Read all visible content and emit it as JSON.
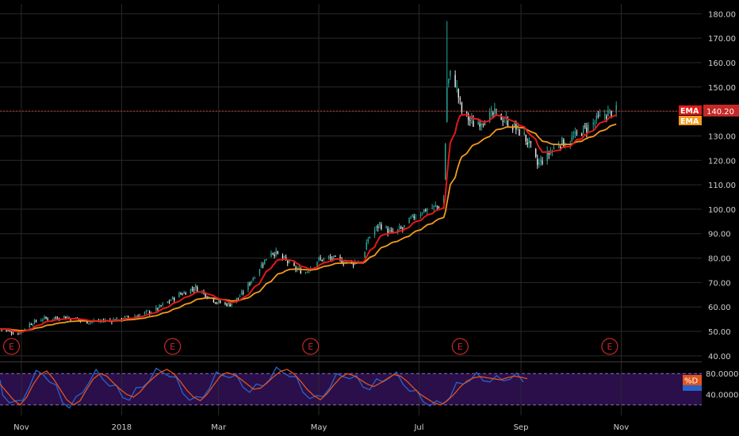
{
  "colors": {
    "background": "#000000",
    "grid": "#2a2a2a",
    "candle_up": "#26a69a",
    "candle_down": "#e8e8e8",
    "ema_fast": "#e01a1a",
    "ema_slow": "#f39a1e",
    "price_line": "#c62828",
    "stoch_k": "#2a62c9",
    "stoch_d": "#e0541c",
    "stoch_fill": "#2a0f4a",
    "earnings": "#c62828",
    "axis_text": "#cfcfcf"
  },
  "chart_data": [
    {
      "type": "candlestick",
      "panel": "price",
      "y_ticks": [
        "40.00",
        "50.00",
        "60.00",
        "70.00",
        "80.00",
        "90.00",
        "100.00",
        "110.00",
        "120.00",
        "130.00",
        "140.00",
        "150.00",
        "160.00",
        "170.00",
        "180.00"
      ],
      "ylim": [
        38,
        184
      ],
      "x_ticks": [
        "Nov",
        "2018",
        "Mar",
        "May",
        "Jul",
        "Sep",
        "Nov"
      ],
      "x_tick_dates": [
        "2017-11-01",
        "2018-01-01",
        "2018-03-01",
        "2018-05-01",
        "2018-07-01",
        "2018-09-01",
        "2018-11-01"
      ],
      "x_range": [
        "2017-10-19",
        "2018-12-20"
      ],
      "price_label": "140.20",
      "price_value": 140.2,
      "legend": [
        {
          "label": "EMA",
          "color": "#e01a1a"
        },
        {
          "label": "EMA",
          "color": "#f39a1e"
        }
      ],
      "earnings_marker_label": "E",
      "earnings_dates": [
        "2017-10-26",
        "2018-02-01",
        "2018-04-26",
        "2018-07-26",
        "2018-10-25"
      ],
      "price_path": [
        [
          "2017-10-19",
          51
        ],
        [
          "2017-10-30",
          49
        ],
        [
          "2017-11-06",
          53
        ],
        [
          "2017-11-13",
          55
        ],
        [
          "2017-11-27",
          56
        ],
        [
          "2017-12-11",
          54
        ],
        [
          "2017-12-25",
          54.5
        ],
        [
          "2018-01-08",
          56
        ],
        [
          "2018-01-22",
          59
        ],
        [
          "2018-02-05",
          65
        ],
        [
          "2018-02-15",
          68
        ],
        [
          "2018-02-28",
          62
        ],
        [
          "2018-03-08",
          61
        ],
        [
          "2018-03-15",
          65
        ],
        [
          "2018-03-26",
          76
        ],
        [
          "2018-04-02",
          83
        ],
        [
          "2018-04-09",
          80
        ],
        [
          "2018-04-16",
          76
        ],
        [
          "2018-04-23",
          74
        ],
        [
          "2018-04-30",
          79
        ],
        [
          "2018-05-07",
          80
        ],
        [
          "2018-05-14",
          79
        ],
        [
          "2018-05-21",
          78
        ],
        [
          "2018-05-28",
          79
        ],
        [
          "2018-05-31",
          88
        ],
        [
          "2018-06-07",
          94
        ],
        [
          "2018-06-14",
          90
        ],
        [
          "2018-06-21",
          92
        ],
        [
          "2018-06-28",
          97
        ],
        [
          "2018-07-05",
          100
        ],
        [
          "2018-07-12",
          101
        ],
        [
          "2018-07-16",
          104
        ],
        [
          "2018-07-18",
          150
        ],
        [
          "2018-07-20",
          155
        ],
        [
          "2018-07-23",
          152
        ],
        [
          "2018-07-27",
          140
        ],
        [
          "2018-08-03",
          135
        ],
        [
          "2018-08-10",
          137
        ],
        [
          "2018-08-17",
          139
        ],
        [
          "2018-08-24",
          136
        ],
        [
          "2018-09-03",
          130
        ],
        [
          "2018-09-07",
          125
        ],
        [
          "2018-09-11",
          118
        ],
        [
          "2018-09-17",
          122
        ],
        [
          "2018-09-24",
          127
        ],
        [
          "2018-10-01",
          128
        ],
        [
          "2018-10-08",
          132
        ],
        [
          "2018-10-15",
          135
        ],
        [
          "2018-10-22",
          139
        ],
        [
          "2018-10-29",
          140.2
        ]
      ]
    },
    {
      "type": "line",
      "panel": "stochastic",
      "y_ticks": [
        "80.0000",
        "40.0000"
      ],
      "ylim": [
        0,
        100
      ],
      "band": [
        20,
        80
      ],
      "legend": [
        {
          "label": "%D",
          "color": "#e0541c"
        }
      ],
      "series": [
        {
          "name": "%D",
          "values": [
            60,
            45,
            30,
            20,
            35,
            60,
            78,
            85,
            70,
            50,
            30,
            20,
            28,
            50,
            70,
            80,
            75,
            62,
            50,
            40,
            35,
            45,
            60,
            72,
            82,
            88,
            80,
            65,
            48,
            35,
            28,
            40,
            58,
            75,
            82,
            78,
            70,
            60,
            50,
            52,
            62,
            74,
            84,
            88,
            80,
            66,
            50,
            38,
            30,
            42,
            58,
            72,
            80,
            76,
            68,
            60,
            55,
            62,
            70,
            78,
            75,
            65,
            52,
            40,
            32,
            24,
            20,
            28,
            40,
            55,
            66,
            72,
            74,
            72,
            70,
            68,
            72,
            75,
            73,
            70
          ]
        }
      ]
    }
  ]
}
